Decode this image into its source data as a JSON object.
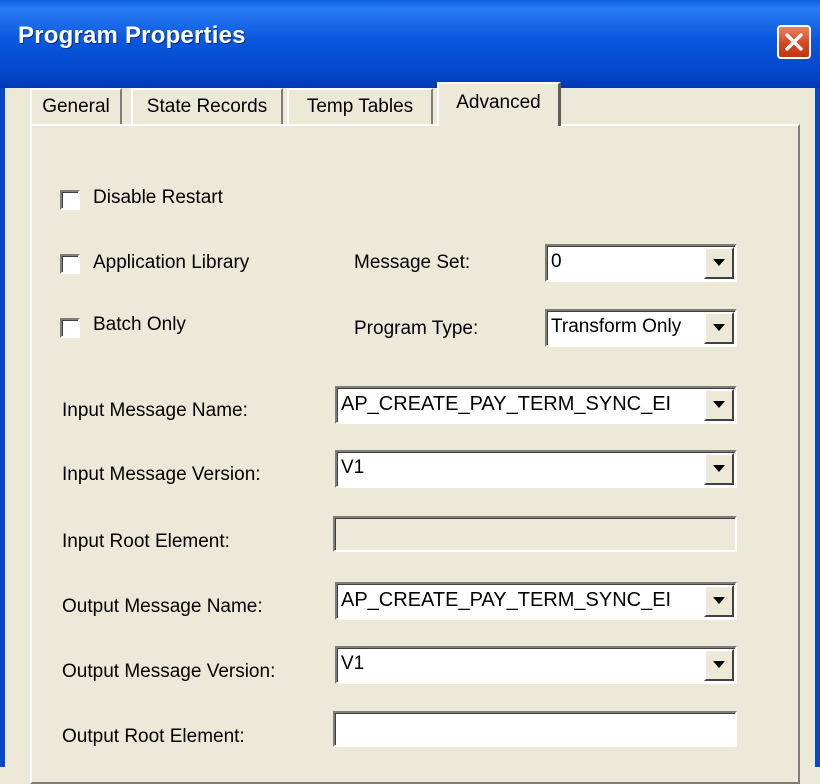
{
  "window": {
    "title": "Program Properties",
    "close_icon": "close-icon",
    "accent_color": "#0a58de",
    "close_color": "#d4461f"
  },
  "tabs": [
    {
      "label": "General",
      "selected": false
    },
    {
      "label": "State Records",
      "selected": false
    },
    {
      "label": "Temp Tables",
      "selected": false
    },
    {
      "label": "Advanced",
      "selected": true
    }
  ],
  "options": {
    "disable_restart": {
      "label": "Disable Restart",
      "checked": false
    },
    "application_library": {
      "label": "Application Library",
      "checked": false
    },
    "batch_only": {
      "label": "Batch Only",
      "checked": false
    }
  },
  "fields": {
    "message_set": {
      "label": "Message Set:",
      "value": "0"
    },
    "program_type": {
      "label": "Program Type:",
      "value": "Transform Only"
    },
    "input_message_name": {
      "label": "Input Message Name:",
      "value": "AP_CREATE_PAY_TERM_SYNC_EI"
    },
    "input_message_version": {
      "label": "Input Message Version:",
      "value": "V1"
    },
    "input_root_element": {
      "label": "Input Root Element:",
      "value": ""
    },
    "output_message_name": {
      "label": "Output Message Name:",
      "value": "AP_CREATE_PAY_TERM_SYNC_EI"
    },
    "output_message_version": {
      "label": "Output Message Version:",
      "value": "V1"
    },
    "output_root_element": {
      "label": "Output Root Element:",
      "value": ""
    }
  }
}
